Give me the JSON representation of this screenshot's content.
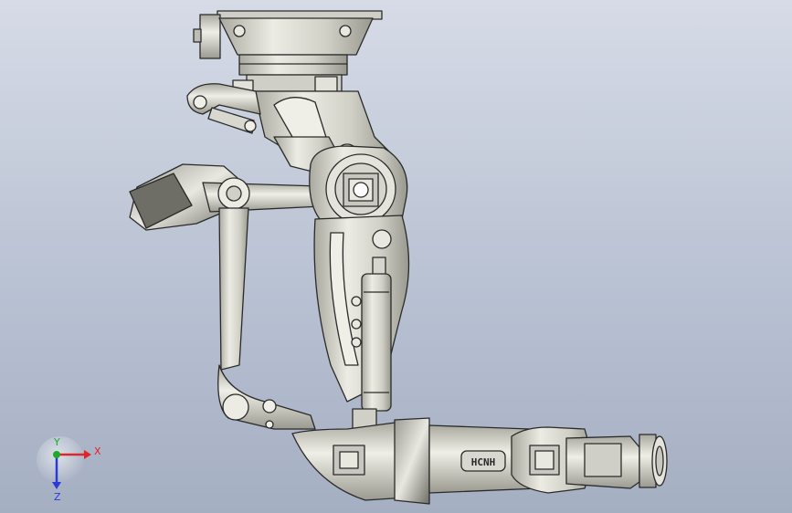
{
  "viewport": {
    "background_top": "#d6dbe6",
    "background_bottom": "#a5afc2"
  },
  "model": {
    "part_fill": "#dcdcd4",
    "part_shade": "#b8b8ae",
    "part_dark": "#9a9a90",
    "edge_color": "#2a2a2a",
    "housing_dark": "#7a7a72"
  },
  "triad": {
    "x_label": "X",
    "y_label": "Y",
    "z_label": "Z",
    "x_color": "#e0242a",
    "y_color": "#1faa2a",
    "z_color": "#2a3ad8"
  }
}
